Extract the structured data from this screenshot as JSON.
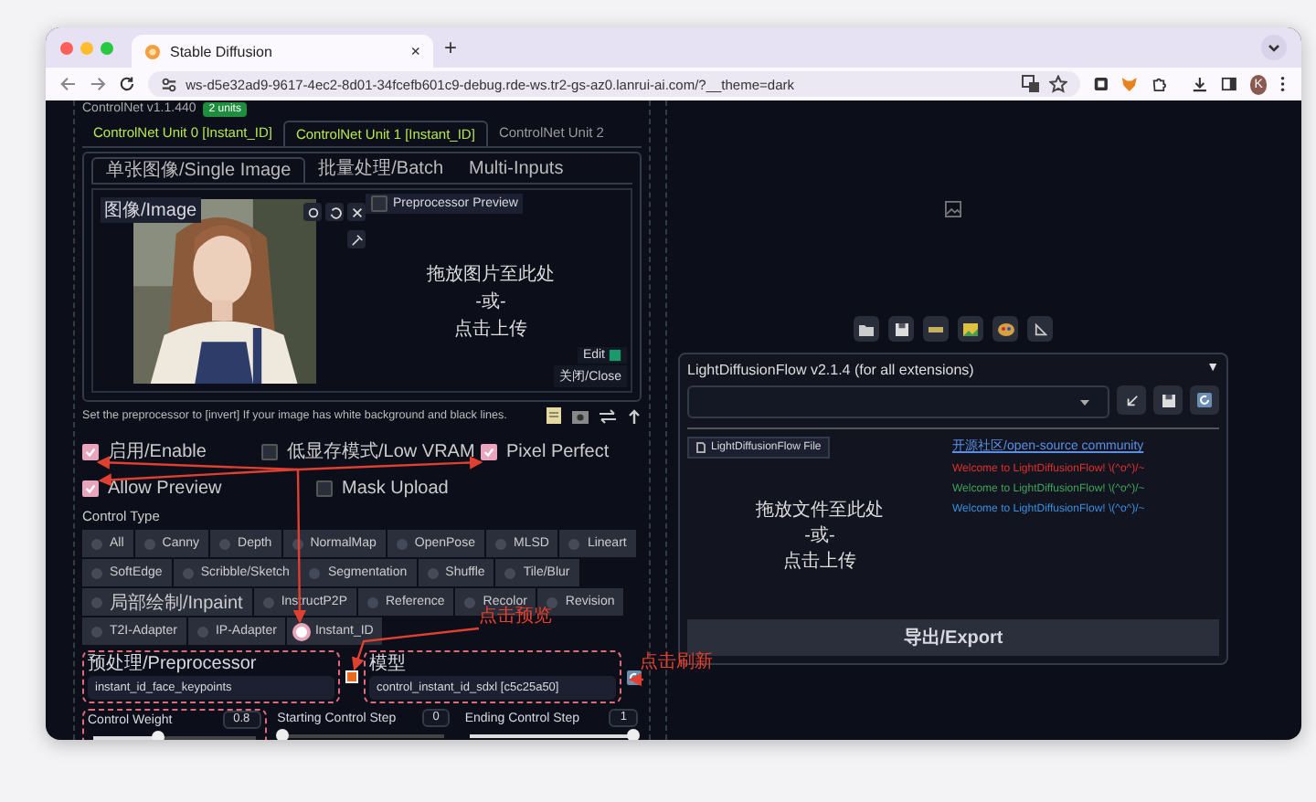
{
  "browser": {
    "tab_title": "Stable Diffusion",
    "tab_close": "×",
    "new_tab": "+",
    "url": "ws-d5e32ad9-9617-4ec2-8d01-34fcefb601c9-debug.rde-ws.tr2-gs-az0.lanrui-ai.com/?__theme=dark",
    "profile": "K"
  },
  "controlnet": {
    "title": "ControlNet v1.1.440",
    "badge": "2 units",
    "units": [
      {
        "label": "ControlNet Unit 0 [Instant_ID]",
        "selected": false,
        "active": true
      },
      {
        "label": "ControlNet Unit 1 [Instant_ID]",
        "selected": true,
        "active": true
      },
      {
        "label": "ControlNet Unit 2",
        "selected": false,
        "active": false
      }
    ],
    "input_tabs": [
      {
        "label": "单张图像/Single Image",
        "selected": true
      },
      {
        "label": "批量处理/Batch",
        "selected": false
      },
      {
        "label": "Multi-Inputs",
        "selected": false
      }
    ],
    "image_label": "图像/Image",
    "preview_label": "Preprocessor Preview",
    "preview_checked": false,
    "drop_text": [
      "拖放图片至此处",
      "-或-",
      "点击上传"
    ],
    "edit": "Edit",
    "close": "关闭/Close",
    "hint": "Set the preprocessor to [invert] If your image has white background and black lines.",
    "options": [
      {
        "label": "启用/Enable",
        "checked": true
      },
      {
        "label": "低显存模式/Low VRAM",
        "checked": false
      },
      {
        "label": "Pixel Perfect",
        "checked": true
      },
      {
        "label": "Allow Preview",
        "checked": true
      },
      {
        "label": "Mask Upload",
        "checked": false
      }
    ],
    "control_type_label": "Control Type",
    "control_types": [
      [
        {
          "label": "All",
          "selected": false
        },
        {
          "label": "Canny",
          "selected": false
        },
        {
          "label": "Depth",
          "selected": false
        },
        {
          "label": "NormalMap",
          "selected": false
        },
        {
          "label": "OpenPose",
          "selected": false
        },
        {
          "label": "MLSD",
          "selected": false
        },
        {
          "label": "Lineart",
          "selected": false
        }
      ],
      [
        {
          "label": "SoftEdge",
          "selected": false
        },
        {
          "label": "Scribble/Sketch",
          "selected": false
        },
        {
          "label": "Segmentation",
          "selected": false
        },
        {
          "label": "Shuffle",
          "selected": false
        },
        {
          "label": "Tile/Blur",
          "selected": false
        }
      ],
      [
        {
          "label": "局部绘制/Inpaint",
          "selected": false
        },
        {
          "label": "InstructP2P",
          "selected": false
        },
        {
          "label": "Reference",
          "selected": false
        },
        {
          "label": "Recolor",
          "selected": false
        },
        {
          "label": "Revision",
          "selected": false
        }
      ],
      [
        {
          "label": "T2I-Adapter",
          "selected": false
        },
        {
          "label": "IP-Adapter",
          "selected": false
        },
        {
          "label": "Instant_ID",
          "selected": true
        }
      ]
    ],
    "preprocessor": {
      "label": "预处理/Preprocessor",
      "value": "instant_id_face_keypoints"
    },
    "model": {
      "label": "模型",
      "value": "control_instant_id_sdxl [c5c25a50]"
    },
    "sliders": [
      {
        "label": "Control Weight",
        "value": "0.8",
        "level": 0.4
      },
      {
        "label": "Starting Control Step",
        "value": "0",
        "level": 0
      },
      {
        "label": "Ending Control Step",
        "value": "1",
        "level": 1
      }
    ]
  },
  "ldf": {
    "title": "LightDiffusionFlow v2.1.4 (for all extensions)",
    "collapse": "▼",
    "file_button": "LightDiffusionFlow File",
    "drop_text": [
      "拖放文件至此处",
      "-或-",
      "点击上传"
    ],
    "link": "开源社区/open-source community",
    "messages": [
      {
        "text": "Welcome to LightDiffusionFlow! \\(^o^)/~",
        "color": "#e0302a"
      },
      {
        "text": "Welcome to LightDiffusionFlow! \\(^o^)/~",
        "color": "#3fa35a"
      },
      {
        "text": "Welcome to LightDiffusionFlow! \\(^o^)/~",
        "color": "#3a8ee0"
      }
    ],
    "export": "导出/Export"
  },
  "annotations": [
    "点击预览",
    "点击刷新"
  ]
}
